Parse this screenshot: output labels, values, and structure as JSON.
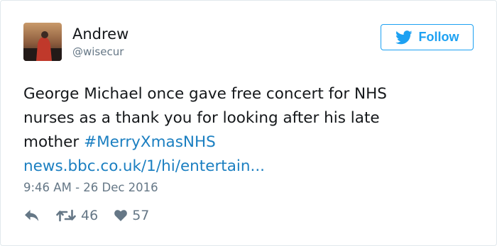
{
  "user": {
    "display_name": "Andrew",
    "username": "@wisecur"
  },
  "follow_button": {
    "label": "Follow"
  },
  "tweet": {
    "line1": "George Michael once gave free concert for NHS",
    "line2": "nurses as a thank you for looking after his late",
    "line3_text": "mother ",
    "hashtag": "#MerryXmasNHS",
    "link": "news.bbc.co.uk/1/hi/entertain...",
    "timestamp": "9:46 AM - 26 Dec 2016"
  },
  "actions": {
    "retweets": "46",
    "likes": "57"
  },
  "icons": {
    "reply": "reply-icon",
    "retweet": "retweet-icon",
    "like": "heart-icon",
    "follow": "twitter-bird-icon"
  },
  "colors": {
    "accent": "#1da1f2",
    "link": "#1b7fc1",
    "text": "#14171a",
    "muted": "#657786"
  }
}
